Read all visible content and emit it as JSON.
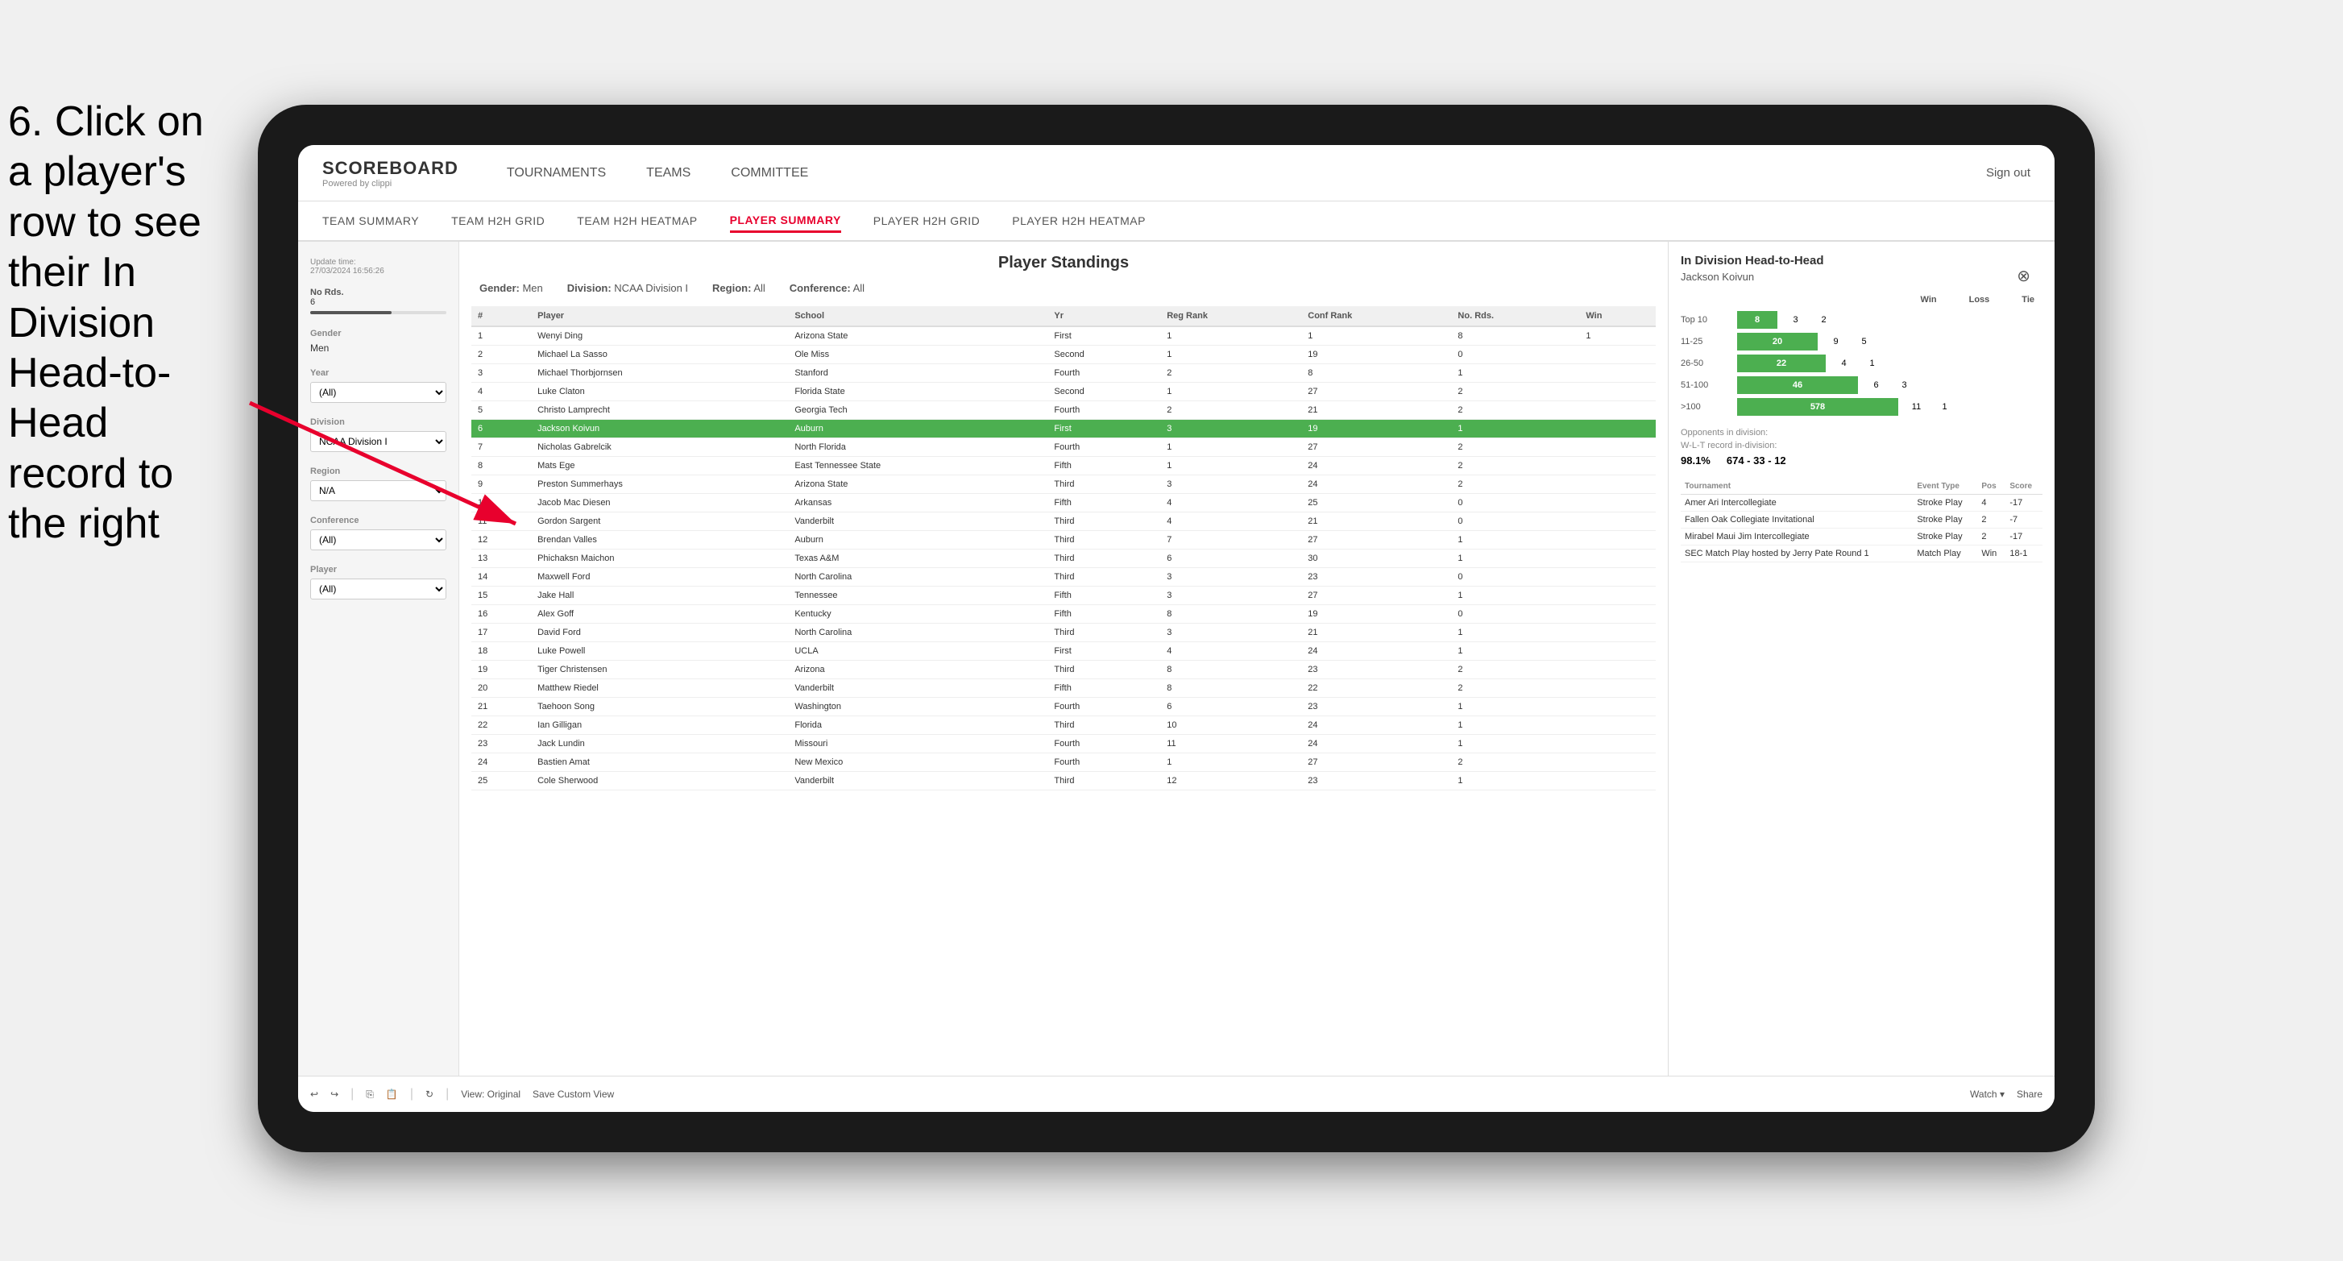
{
  "instruction": {
    "text": "6. Click on a player's row to see their In Division Head-to-Head record to the right"
  },
  "nav": {
    "logo_title": "SCOREBOARD",
    "logo_sub": "Powered by clippi",
    "items": [
      "TOURNAMENTS",
      "TEAMS",
      "COMMITTEE"
    ],
    "sign_out": "Sign out"
  },
  "sub_nav": {
    "items": [
      "TEAM SUMMARY",
      "TEAM H2H GRID",
      "TEAM H2H HEATMAP",
      "PLAYER SUMMARY",
      "PLAYER H2H GRID",
      "PLAYER H2H HEATMAP"
    ],
    "active": "PLAYER SUMMARY"
  },
  "sidebar": {
    "update_label": "Update time:",
    "update_time": "27/03/2024 16:56:26",
    "no_rds_label": "No Rds.",
    "no_rds_value": "6",
    "gender_label": "Gender",
    "gender_value": "Men",
    "year_label": "Year",
    "year_value": "(All)",
    "division_label": "Division",
    "division_value": "NCAA Division I",
    "region_label": "Region",
    "region_value": "N/A",
    "conference_label": "Conference",
    "conference_value": "(All)",
    "player_label": "Player",
    "player_value": "(All)"
  },
  "standings": {
    "title": "Player Standings",
    "filters": {
      "gender_label": "Gender:",
      "gender_value": "Men",
      "division_label": "Division:",
      "division_value": "NCAA Division I",
      "region_label": "Region:",
      "region_value": "All",
      "conference_label": "Conference:",
      "conference_value": "All"
    },
    "columns": [
      "#",
      "Player",
      "School",
      "Yr",
      "Reg Rank",
      "Conf Rank",
      "No. Rds.",
      "Win"
    ],
    "rows": [
      {
        "rank": "1",
        "player": "Wenyi Ding",
        "school": "Arizona State",
        "yr": "First",
        "reg": "1",
        "conf": "1",
        "rds": "8",
        "win": "1"
      },
      {
        "rank": "2",
        "player": "Michael La Sasso",
        "school": "Ole Miss",
        "yr": "Second",
        "reg": "1",
        "conf": "19",
        "rds": "0"
      },
      {
        "rank": "3",
        "player": "Michael Thorbjornsen",
        "school": "Stanford",
        "yr": "Fourth",
        "reg": "2",
        "conf": "8",
        "rds": "1"
      },
      {
        "rank": "4",
        "player": "Luke Claton",
        "school": "Florida State",
        "yr": "Second",
        "reg": "1",
        "conf": "27",
        "rds": "2"
      },
      {
        "rank": "5",
        "player": "Christo Lamprecht",
        "school": "Georgia Tech",
        "yr": "Fourth",
        "reg": "2",
        "conf": "21",
        "rds": "2"
      },
      {
        "rank": "6",
        "player": "Jackson Koivun",
        "school": "Auburn",
        "yr": "First",
        "reg": "3",
        "conf": "19",
        "rds": "1",
        "highlighted": true
      },
      {
        "rank": "7",
        "player": "Nicholas Gabrelcik",
        "school": "North Florida",
        "yr": "Fourth",
        "reg": "1",
        "conf": "27",
        "rds": "2"
      },
      {
        "rank": "8",
        "player": "Mats Ege",
        "school": "East Tennessee State",
        "yr": "Fifth",
        "reg": "1",
        "conf": "24",
        "rds": "2"
      },
      {
        "rank": "9",
        "player": "Preston Summerhays",
        "school": "Arizona State",
        "yr": "Third",
        "reg": "3",
        "conf": "24",
        "rds": "2"
      },
      {
        "rank": "10",
        "player": "Jacob Mac Diesen",
        "school": "Arkansas",
        "yr": "Fifth",
        "reg": "4",
        "conf": "25",
        "rds": "0"
      },
      {
        "rank": "11",
        "player": "Gordon Sargent",
        "school": "Vanderbilt",
        "yr": "Third",
        "reg": "4",
        "conf": "21",
        "rds": "0"
      },
      {
        "rank": "12",
        "player": "Brendan Valles",
        "school": "Auburn",
        "yr": "Third",
        "reg": "7",
        "conf": "27",
        "rds": "1"
      },
      {
        "rank": "13",
        "player": "Phichaksn Maichon",
        "school": "Texas A&M",
        "yr": "Third",
        "reg": "6",
        "conf": "30",
        "rds": "1"
      },
      {
        "rank": "14",
        "player": "Maxwell Ford",
        "school": "North Carolina",
        "yr": "Third",
        "reg": "3",
        "conf": "23",
        "rds": "0"
      },
      {
        "rank": "15",
        "player": "Jake Hall",
        "school": "Tennessee",
        "yr": "Fifth",
        "reg": "3",
        "conf": "27",
        "rds": "1"
      },
      {
        "rank": "16",
        "player": "Alex Goff",
        "school": "Kentucky",
        "yr": "Fifth",
        "reg": "8",
        "conf": "19",
        "rds": "0"
      },
      {
        "rank": "17",
        "player": "David Ford",
        "school": "North Carolina",
        "yr": "Third",
        "reg": "3",
        "conf": "21",
        "rds": "1"
      },
      {
        "rank": "18",
        "player": "Luke Powell",
        "school": "UCLA",
        "yr": "First",
        "reg": "4",
        "conf": "24",
        "rds": "1"
      },
      {
        "rank": "19",
        "player": "Tiger Christensen",
        "school": "Arizona",
        "yr": "Third",
        "reg": "8",
        "conf": "23",
        "rds": "2"
      },
      {
        "rank": "20",
        "player": "Matthew Riedel",
        "school": "Vanderbilt",
        "yr": "Fifth",
        "reg": "8",
        "conf": "22",
        "rds": "2"
      },
      {
        "rank": "21",
        "player": "Taehoon Song",
        "school": "Washington",
        "yr": "Fourth",
        "reg": "6",
        "conf": "23",
        "rds": "1"
      },
      {
        "rank": "22",
        "player": "Ian Gilligan",
        "school": "Florida",
        "yr": "Third",
        "reg": "10",
        "conf": "24",
        "rds": "1"
      },
      {
        "rank": "23",
        "player": "Jack Lundin",
        "school": "Missouri",
        "yr": "Fourth",
        "reg": "11",
        "conf": "24",
        "rds": "1"
      },
      {
        "rank": "24",
        "player": "Bastien Amat",
        "school": "New Mexico",
        "yr": "Fourth",
        "reg": "1",
        "conf": "27",
        "rds": "2"
      },
      {
        "rank": "25",
        "player": "Cole Sherwood",
        "school": "Vanderbilt",
        "yr": "Third",
        "reg": "12",
        "conf": "23",
        "rds": "1"
      }
    ]
  },
  "h2h": {
    "title": "In Division Head-to-Head",
    "player_name": "Jackson Koivun",
    "columns": [
      "Win",
      "Loss",
      "Tie"
    ],
    "rows": [
      {
        "label": "Top 10",
        "win": 8,
        "win_width": 50,
        "loss": 3,
        "tie": 2
      },
      {
        "label": "11-25",
        "win": 20,
        "win_width": 100,
        "loss": 9,
        "tie": 5
      },
      {
        "label": "26-50",
        "win": 22,
        "win_width": 110,
        "loss": 4,
        "tie": 1
      },
      {
        "label": "51-100",
        "win": 46,
        "win_width": 150,
        "loss": 6,
        "tie": 3
      },
      {
        "label": ">100",
        "win": 578,
        "win_width": 200,
        "loss": 11,
        "tie": 1
      }
    ],
    "opponents_label": "Opponents in division:",
    "wlt_label": "W-L-T record in-division:",
    "wlt_pct": "98.1%",
    "wlt_record": "674 - 33 - 12",
    "tournament_columns": [
      "Tournament",
      "Event Type",
      "Pos",
      "Score"
    ],
    "tournaments": [
      {
        "name": "Amer Ari Intercollegiate",
        "type": "Stroke Play",
        "pos": "4",
        "score": "-17"
      },
      {
        "name": "Fallen Oak Collegiate Invitational",
        "type": "Stroke Play",
        "pos": "2",
        "score": "-7"
      },
      {
        "name": "Mirabel Maui Jim Intercollegiate",
        "type": "Stroke Play",
        "pos": "2",
        "score": "-17"
      },
      {
        "name": "SEC Match Play hosted by Jerry Pate Round 1",
        "type": "Match Play",
        "pos": "Win",
        "score": "18-1"
      }
    ]
  },
  "toolbar": {
    "view_original": "View: Original",
    "save_custom": "Save Custom View",
    "watch": "Watch ▾",
    "share": "Share"
  }
}
